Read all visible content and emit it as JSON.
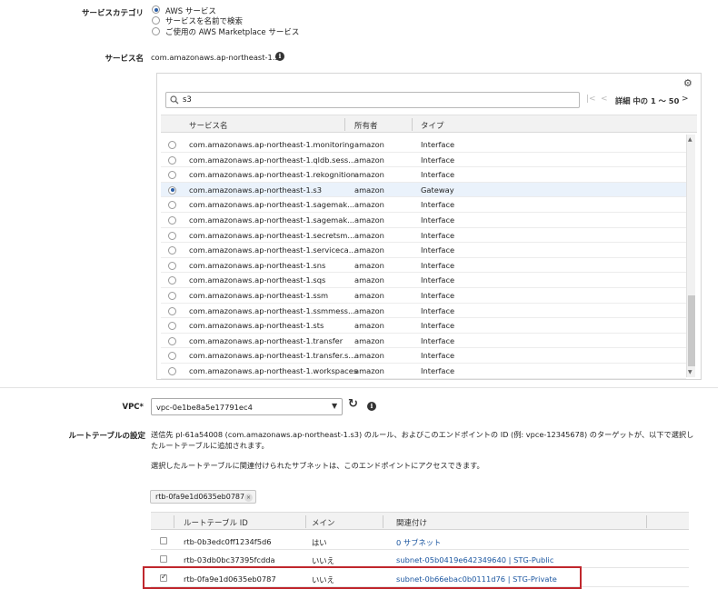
{
  "service_category": {
    "label": "サービスカテゴリ",
    "options": [
      {
        "label": "AWS サービス",
        "selected": true
      },
      {
        "label": "サービスを名前で検索",
        "selected": false
      },
      {
        "label": "ご使用の AWS Marketplace サービス",
        "selected": false
      }
    ]
  },
  "service_name": {
    "label": "サービス名",
    "value": "com.amazonaws.ap-northeast-1.s3"
  },
  "service_table": {
    "search_value": "s3",
    "pager_text": "詳細 中の 1 ～ 50",
    "columns": [
      "サービス名",
      "所有者",
      "タイプ"
    ],
    "rows": [
      {
        "name": "com.amazonaws.ap-northeast-1.monitoring",
        "owner": "amazon",
        "type": "Interface",
        "selected": false
      },
      {
        "name": "com.amazonaws.ap-northeast-1.qldb.sess...",
        "owner": "amazon",
        "type": "Interface",
        "selected": false
      },
      {
        "name": "com.amazonaws.ap-northeast-1.rekognition",
        "owner": "amazon",
        "type": "Interface",
        "selected": false
      },
      {
        "name": "com.amazonaws.ap-northeast-1.s3",
        "owner": "amazon",
        "type": "Gateway",
        "selected": true
      },
      {
        "name": "com.amazonaws.ap-northeast-1.sagemak...",
        "owner": "amazon",
        "type": "Interface",
        "selected": false
      },
      {
        "name": "com.amazonaws.ap-northeast-1.sagemak...",
        "owner": "amazon",
        "type": "Interface",
        "selected": false
      },
      {
        "name": "com.amazonaws.ap-northeast-1.secretsm...",
        "owner": "amazon",
        "type": "Interface",
        "selected": false
      },
      {
        "name": "com.amazonaws.ap-northeast-1.serviceca...",
        "owner": "amazon",
        "type": "Interface",
        "selected": false
      },
      {
        "name": "com.amazonaws.ap-northeast-1.sns",
        "owner": "amazon",
        "type": "Interface",
        "selected": false
      },
      {
        "name": "com.amazonaws.ap-northeast-1.sqs",
        "owner": "amazon",
        "type": "Interface",
        "selected": false
      },
      {
        "name": "com.amazonaws.ap-northeast-1.ssm",
        "owner": "amazon",
        "type": "Interface",
        "selected": false
      },
      {
        "name": "com.amazonaws.ap-northeast-1.ssmmess...",
        "owner": "amazon",
        "type": "Interface",
        "selected": false
      },
      {
        "name": "com.amazonaws.ap-northeast-1.sts",
        "owner": "amazon",
        "type": "Interface",
        "selected": false
      },
      {
        "name": "com.amazonaws.ap-northeast-1.transfer",
        "owner": "amazon",
        "type": "Interface",
        "selected": false
      },
      {
        "name": "com.amazonaws.ap-northeast-1.transfer.s...",
        "owner": "amazon",
        "type": "Interface",
        "selected": false
      },
      {
        "name": "com.amazonaws.ap-northeast-1.workspaces",
        "owner": "amazon",
        "type": "Interface",
        "selected": false
      }
    ]
  },
  "vpc": {
    "label": "VPC*",
    "value": "vpc-0e1be8a5e17791ec4"
  },
  "route_table": {
    "label": "ルートテーブルの設定",
    "desc_line1": "送信先 pl-61a54008 (com.amazonaws.ap-northeast-1.s3) のルール、およびこのエンドポイントの ID (例: vpce-12345678) のターゲットが、以下で選択し",
    "desc_line2": "たルートテーブルに追加されます。",
    "desc_line3": "選択したルートテーブルに関連付けられたサブネットは、このエンドポイントにアクセスできます。",
    "chip": "rtb-0fa9e1d0635eb0787",
    "columns": [
      "ルートテーブル ID",
      "メイン",
      "関連付け"
    ],
    "rows": [
      {
        "id": "rtb-0b3edc0ff1234f5d6",
        "main": "はい",
        "assoc": "0 サブネット",
        "checked": false
      },
      {
        "id": "rtb-03db0bc37395fcdda",
        "main": "いいえ",
        "assoc": "subnet-05b0419e642349640 | STG-Public",
        "checked": false
      },
      {
        "id": "rtb-0fa9e1d0635eb0787",
        "main": "いいえ",
        "assoc": "subnet-0b66ebac0b0111d76 | STG-Private",
        "checked": true
      }
    ]
  }
}
